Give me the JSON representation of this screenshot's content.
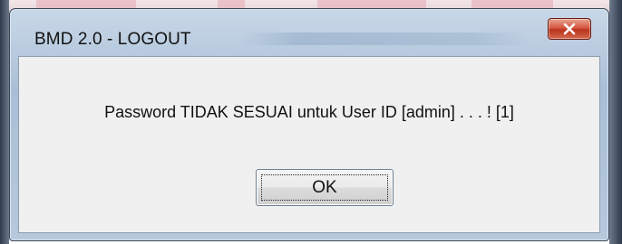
{
  "dialog": {
    "title": "BMD 2.0 - LOGOUT",
    "message": "Password TIDAK SESUAI untuk User ID [admin] . . . ! [1]",
    "ok_label": "OK",
    "close_icon": "close-icon"
  },
  "colors": {
    "close_button": "#c8432a",
    "client_background": "#f0f0f0",
    "frame": "#b6c8dc"
  }
}
